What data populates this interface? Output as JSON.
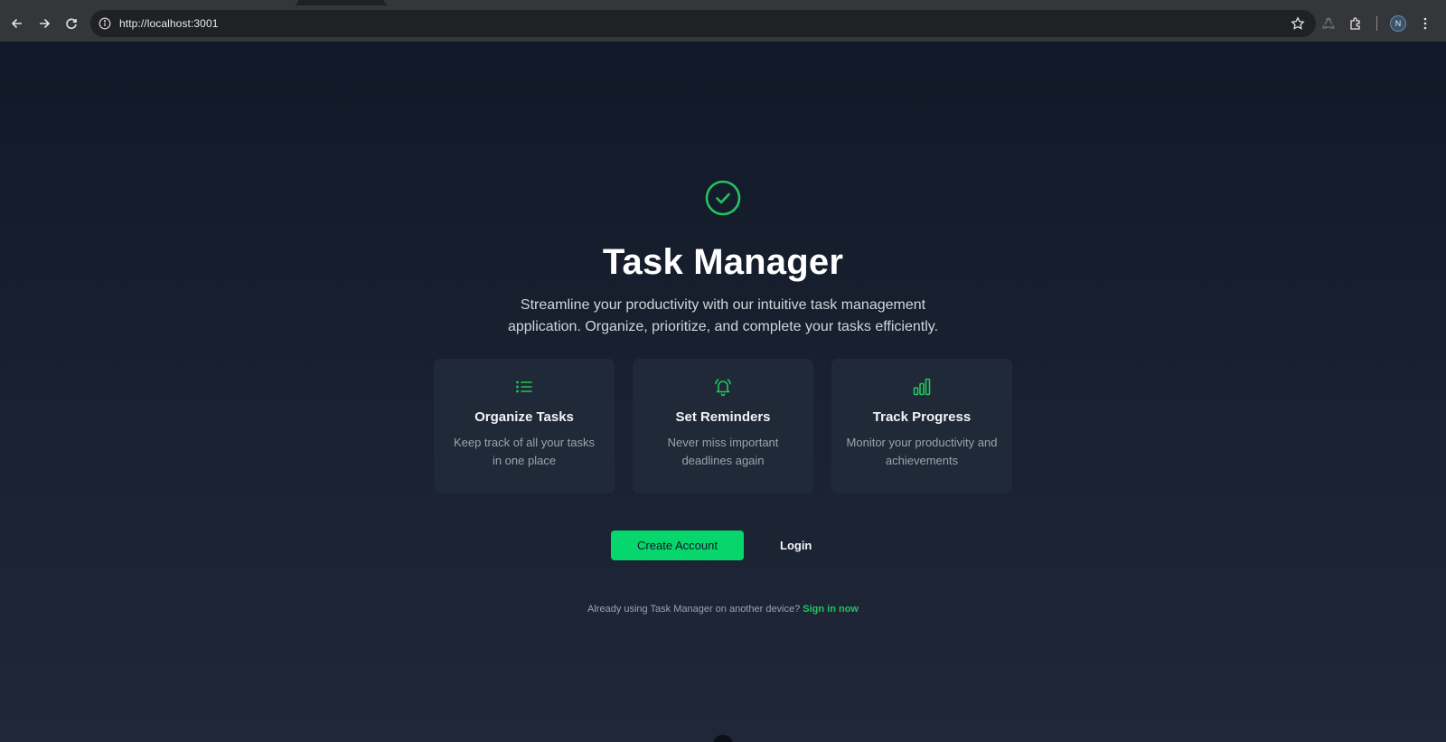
{
  "browser": {
    "url": "http://localhost:3001",
    "profile_initial": "N"
  },
  "hero": {
    "icon": "check-circle-icon",
    "title": "Task Manager",
    "subtitle": "Streamline your productivity with our intuitive task management application. Organize, prioritize, and complete your tasks efficiently."
  },
  "features": [
    {
      "icon": "list-icon",
      "title": "Organize Tasks",
      "description": "Keep track of all your tasks in one place"
    },
    {
      "icon": "bell-icon",
      "title": "Set Reminders",
      "description": "Never miss important deadlines again"
    },
    {
      "icon": "bar-chart-icon",
      "title": "Track Progress",
      "description": "Monitor your productivity and achievements"
    }
  ],
  "actions": {
    "create_account": "Create Account",
    "login": "Login"
  },
  "footer": {
    "prompt": "Already using Task Manager on another device?",
    "sign_in": "Sign in now"
  },
  "colors": {
    "accent": "#22c55e",
    "button": "#06d66b",
    "background": "#111827",
    "card": "#1f2937"
  }
}
